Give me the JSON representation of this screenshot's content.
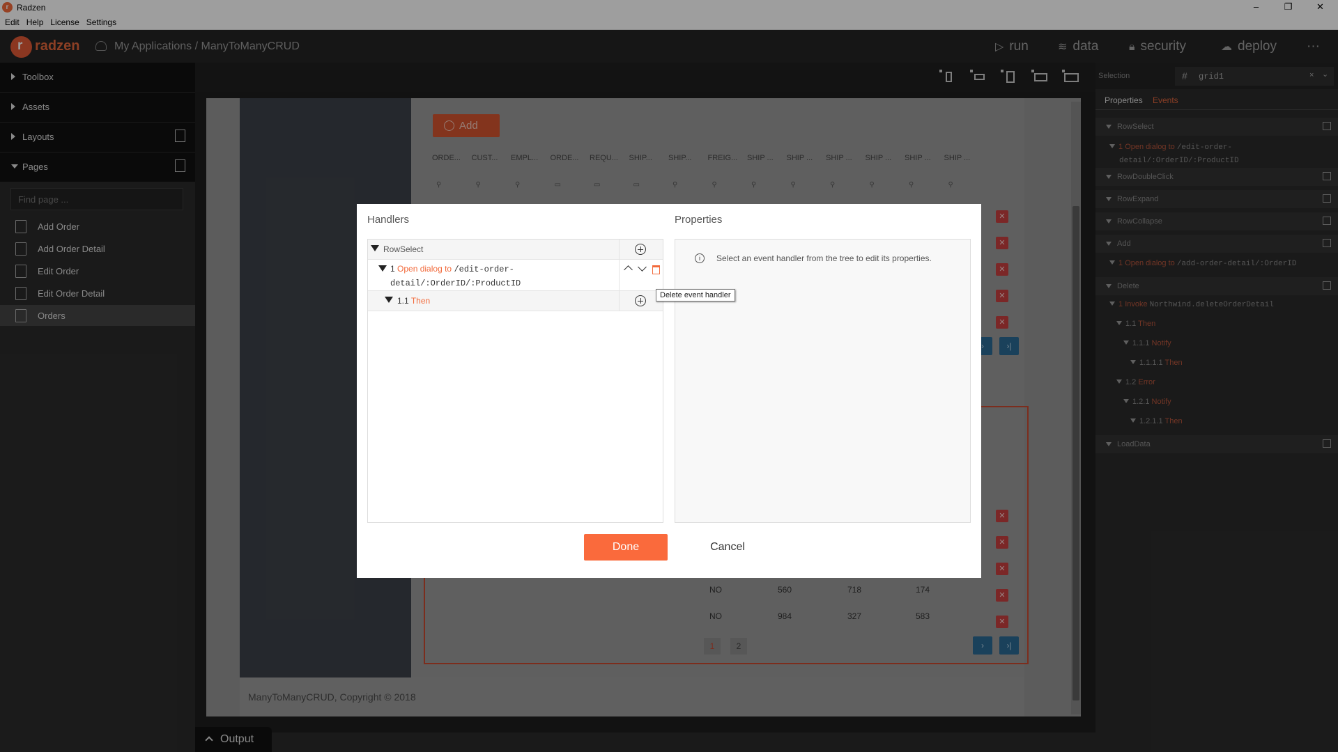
{
  "window": {
    "title": "Radzen",
    "minimize": "–",
    "restore": "❐",
    "close": "✕"
  },
  "menu": [
    "Edit",
    "Help",
    "License",
    "Settings"
  ],
  "header": {
    "brand": "radzen",
    "breadcrumb": "My Applications / ManyToManyCRUD",
    "nav": [
      {
        "label": "run",
        "icon": "play-icon"
      },
      {
        "label": "data",
        "icon": "layers-icon"
      },
      {
        "label": "security",
        "icon": "lock-icon"
      },
      {
        "label": "deploy",
        "icon": "cloud-upload-icon"
      }
    ],
    "more": "···"
  },
  "sidebar": {
    "sections": {
      "toolbox": "Toolbox",
      "assets": "Assets",
      "layouts": "Layouts",
      "pages": "Pages"
    },
    "search_placeholder": "Find page ...",
    "pages": [
      "Add Order",
      "Add Order Detail",
      "Edit Order",
      "Edit Order Detail",
      "Orders"
    ],
    "active_page": "Orders"
  },
  "canvas": {
    "add_button": "Add",
    "columns": [
      "ORDE...",
      "CUST...",
      "EMPL...",
      "ORDE...",
      "REQU...",
      "SHIP...",
      "SHIP...",
      "FREIG...",
      "SHIP ...",
      "SHIP ...",
      "SHIP ...",
      "SHIP ...",
      "SHIP ...",
      "SHIP ..."
    ],
    "rows": [
      {
        "a": "NO",
        "b": "560",
        "c": "718",
        "d": "174"
      },
      {
        "a": "NO",
        "b": "984",
        "c": "327",
        "d": "583"
      }
    ],
    "pages": [
      "1",
      "2"
    ],
    "footer": "ManyToManyCRUD, Copyright © 2018"
  },
  "right_panel": {
    "selection_label": "Selection",
    "selection_value": "grid1",
    "tabs": {
      "properties": "Properties",
      "events": "Events"
    },
    "events": [
      {
        "name": "RowSelect"
      },
      {
        "name": "RowDoubleClick"
      },
      {
        "name": "RowExpand"
      },
      {
        "name": "RowCollapse"
      },
      {
        "name": "Add"
      },
      {
        "name": "Delete"
      },
      {
        "name": "LoadData"
      }
    ],
    "rowselect_handler": {
      "num": "1",
      "action": "Open dialog to",
      "path1": "/edit-order-",
      "path2": "detail/:OrderID/:ProductID"
    },
    "add_handler": {
      "num": "1",
      "action": "Open dialog to",
      "path": "/add-order-detail/:OrderID"
    },
    "delete_tree": [
      {
        "num": "1",
        "label": "Invoke",
        "extra": "Northwind.deleteOrderDetail"
      },
      {
        "num": "1.1",
        "label": "Then"
      },
      {
        "num": "1.1.1",
        "label": "Notify"
      },
      {
        "num": "1.1.1.1",
        "label": "Then"
      },
      {
        "num": "1.2",
        "label": "Error"
      },
      {
        "num": "1.2.1",
        "label": "Notify"
      },
      {
        "num": "1.2.1.1",
        "label": "Then"
      }
    ]
  },
  "dialog": {
    "handlers_title": "Handlers",
    "properties_title": "Properties",
    "event_name": "RowSelect",
    "handler": {
      "num": "1",
      "action": "Open dialog to",
      "path1": "/edit-order-",
      "path2": "detail/:OrderID/:ProductID"
    },
    "sub_handler": {
      "num": "1.1",
      "label": "Then"
    },
    "properties_hint": "Select an event handler from the tree to edit its properties.",
    "tooltip": "Delete event handler",
    "done": "Done",
    "cancel": "Cancel"
  },
  "output": {
    "label": "Output"
  }
}
